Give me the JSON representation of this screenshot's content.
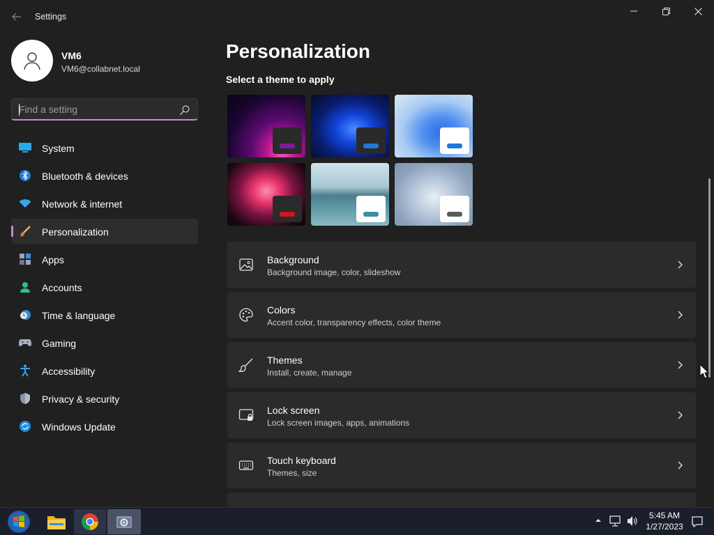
{
  "window": {
    "title": "Settings",
    "back_icon": "back-arrow-icon",
    "controls": [
      "minimize-icon",
      "restore-icon",
      "close-icon"
    ]
  },
  "profile": {
    "name": "VM6",
    "email": "VM6@collabnet.local",
    "avatar_icon": "person-icon"
  },
  "search": {
    "placeholder": "Find a setting",
    "value": "",
    "icon": "search-icon"
  },
  "sidebar": {
    "selected": "Personalization",
    "accent": "#c08cd8",
    "items": [
      {
        "label": "System",
        "icon": "system-icon"
      },
      {
        "label": "Bluetooth & devices",
        "icon": "bluetooth-icon"
      },
      {
        "label": "Network & internet",
        "icon": "wifi-icon"
      },
      {
        "label": "Personalization",
        "icon": "brush-icon"
      },
      {
        "label": "Apps",
        "icon": "apps-icon"
      },
      {
        "label": "Accounts",
        "icon": "accounts-icon"
      },
      {
        "label": "Time & language",
        "icon": "clock-globe-icon"
      },
      {
        "label": "Gaming",
        "icon": "gamepad-icon"
      },
      {
        "label": "Accessibility",
        "icon": "accessibility-icon"
      },
      {
        "label": "Privacy & security",
        "icon": "shield-icon"
      },
      {
        "label": "Windows Update",
        "icon": "update-icon"
      }
    ]
  },
  "main": {
    "title": "Personalization",
    "themes_label": "Select a theme to apply",
    "themes": [
      {
        "chip_color": "#2a2a2a",
        "bar_color": "#7d1c9a"
      },
      {
        "chip_color": "#2a2a2a",
        "bar_color": "#1e78d8"
      },
      {
        "chip_color": "#ffffff",
        "bar_color": "#1e78d8"
      },
      {
        "chip_color": "#2a2a2a",
        "bar_color": "#d8121e"
      },
      {
        "chip_color": "#ffffff",
        "bar_color": "#3a8fa8"
      },
      {
        "chip_color": "#ffffff",
        "bar_color": "#5a5a5a"
      }
    ],
    "cards": [
      {
        "title": "Background",
        "subtitle": "Background image, color, slideshow",
        "icon": "image-icon"
      },
      {
        "title": "Colors",
        "subtitle": "Accent color, transparency effects, color theme",
        "icon": "palette-icon"
      },
      {
        "title": "Themes",
        "subtitle": "Install, create, manage",
        "icon": "brush-icon"
      },
      {
        "title": "Lock screen",
        "subtitle": "Lock screen images, apps, animations",
        "icon": "lock-screen-icon"
      },
      {
        "title": "Touch keyboard",
        "subtitle": "Themes, size",
        "icon": "keyboard-icon"
      }
    ]
  },
  "taskbar": {
    "apps": [
      "windows-start-icon",
      "file-explorer-icon",
      "chrome-icon",
      "settings-icon"
    ],
    "time": "5:45 AM",
    "date": "1/27/2023",
    "tray_icons": [
      "chevron-up-icon",
      "network-icon",
      "volume-icon",
      "notification-icon"
    ]
  }
}
